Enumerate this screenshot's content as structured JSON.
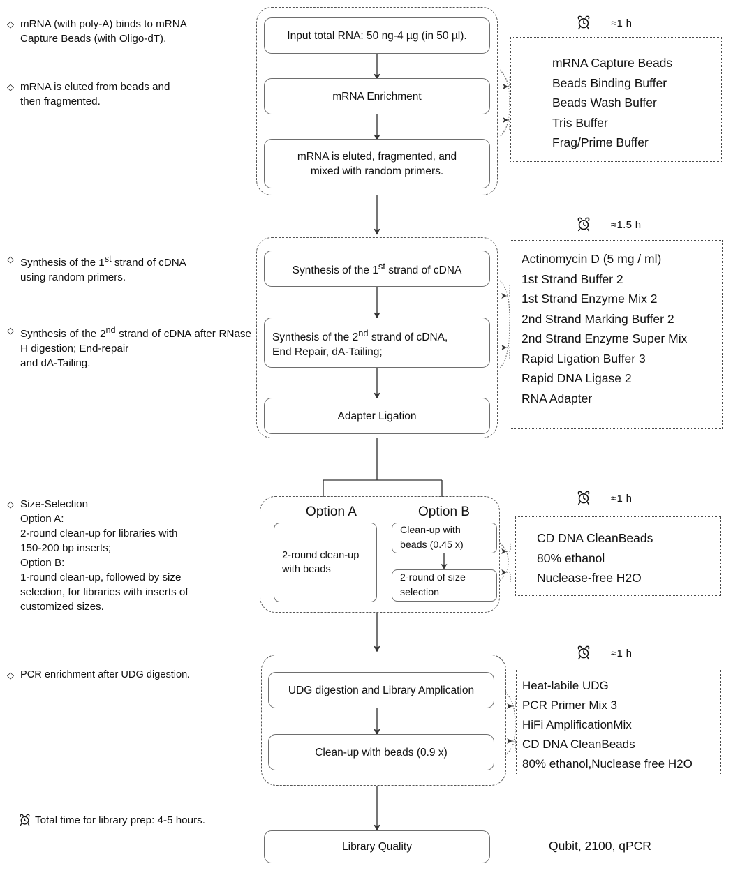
{
  "diagram": {
    "title": "mRNA library prep workflow",
    "icons": {
      "clock": "alarm-clock-icon",
      "bullet": "diamond-bullet"
    }
  },
  "notes": {
    "n1_line1": "mRNA (with poly-A) binds to mRNA",
    "n1_line2": "Capture Beads (with Oligo-dT).",
    "n2_line1": "mRNA is eluted from beads and",
    "n2_line2": "then fragmented.",
    "n3_line1": "Synthesis of the 1",
    "n3_sup1": "st",
    "n3_line1b": " strand of cDNA",
    "n3_line2": "using random primers.",
    "n4_line1": "Synthesis of the 2",
    "n4_sup1": "nd",
    "n4_line1b": " strand of cDNA",
    "n4_line2": "after RNase H digestion; End-repair",
    "n4_line3": "and dA-Tailing.",
    "n5_title": "Size-Selection",
    "n5_l1": "Option A:",
    "n5_l2": "2-round clean-up for libraries with",
    "n5_l3": "150-200 bp inserts;",
    "n5_l4": "Option B:",
    "n5_l5": "1-round clean-up, followed by size",
    "n5_l6": "selection, for libraries with inserts of",
    "n5_l7": "customized sizes.",
    "n6": "PCR enrichment after UDG digestion.",
    "total_time": "Total time for library prep: 4-5 hours."
  },
  "stage1": {
    "time": "≈1 h",
    "boxes": {
      "input": "Input total RNA: 50 ng-4 µg (in 50 µl).",
      "enrichment": "mRNA Enrichment",
      "eluted_l1": "mRNA is eluted, fragmented, and",
      "eluted_l2": "mixed with random primers."
    },
    "reagents": [
      "mRNA Capture Beads",
      "Beads Binding Buffer",
      "Beads Wash Buffer",
      "Tris Buffer",
      "Frag/Prime Buffer"
    ]
  },
  "stage2": {
    "time": "≈1.5 h",
    "boxes": {
      "first_strand_a": "Synthesis of the 1",
      "first_strand_sup": "st",
      "first_strand_b": " strand of cDNA",
      "second_strand_a": "Synthesis of the 2",
      "second_strand_sup": "nd",
      "second_strand_b": " strand of cDNA,",
      "second_strand_l2": "End Repair, dA-Tailing;",
      "adapter": "Adapter Ligation"
    },
    "reagents": [
      "Actinomycin D (5 mg / ml)",
      "1st Strand Buffer 2",
      "1st Strand Enzyme Mix 2",
      "2nd Strand Marking Buffer 2",
      "2nd Strand Enzyme Super Mix",
      "Rapid Ligation Buffer 3",
      "Rapid DNA Ligase 2",
      "RNA Adapter"
    ]
  },
  "stage3": {
    "time": "≈1 h",
    "option_a_label": "Option A",
    "option_b_label": "Option B",
    "option_a_box_l1": "2-round clean-up",
    "option_a_box_l2": "with beads",
    "option_b_box1_l1": "Clean-up with",
    "option_b_box1_l2": "beads (0.45 x)",
    "option_b_box2_l1": "2-round of size",
    "option_b_box2_l2": "selection",
    "reagents": [
      "CD DNA CleanBeads",
      "80% ethanol",
      "Nuclease-free H2O"
    ]
  },
  "stage4": {
    "time": "≈1 h",
    "boxes": {
      "udg": "UDG digestion and Library Amplication",
      "cleanup": "Clean-up with beads (0.9 x)"
    },
    "reagents": [
      "Heat-labile UDG",
      "PCR Primer Mix 3",
      "HiFi AmplificationMix",
      "CD DNA CleanBeads",
      "80% ethanol,Nuclease free H2O"
    ]
  },
  "stage5": {
    "box": "Library Quality",
    "qc_methods": "Qubit, 2100, qPCR"
  },
  "colors": {
    "box_border": "#6e6e6e",
    "dash_border": "#555555",
    "dot_border": "#4a4a4a",
    "text": "#111111",
    "arrow": "#333333"
  }
}
